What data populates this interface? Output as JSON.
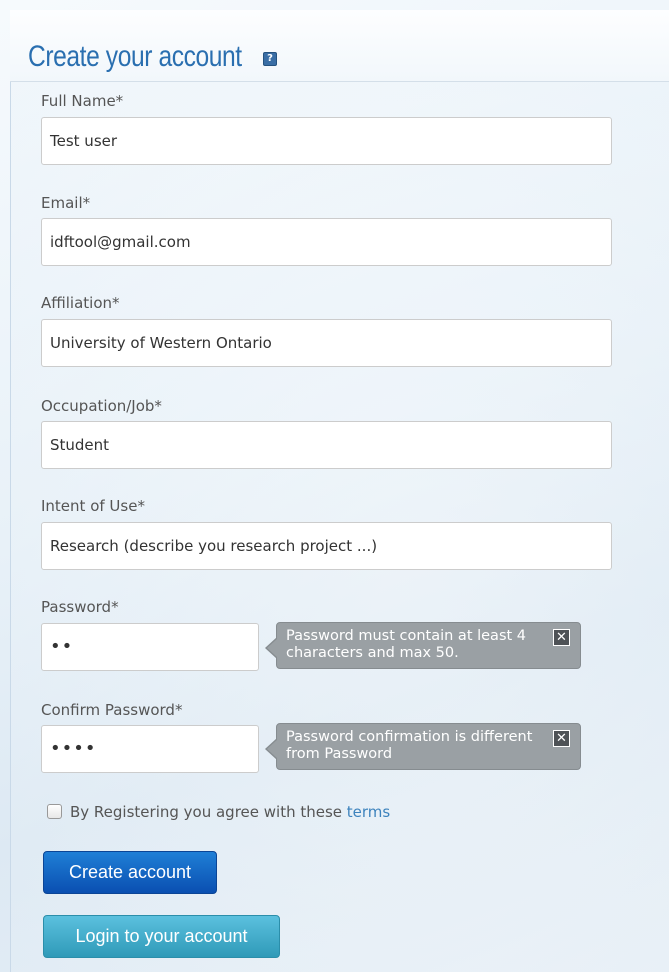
{
  "header": {
    "title": "Create your account",
    "help_icon": "help-icon"
  },
  "form": {
    "fields": [
      {
        "label": "Full Name*",
        "value": "Test user"
      },
      {
        "label": "Email*",
        "value": "idftool@gmail.com"
      },
      {
        "label": "Affiliation*",
        "value": "University of Western Ontario"
      },
      {
        "label": "Occupation/Job*",
        "value": "Student"
      },
      {
        "label": "Intent of Use*",
        "value": "Research (describe you research project ...)"
      }
    ],
    "password": {
      "label": "Password*",
      "value": "••",
      "error": "Password must contain at least 4 characters and max 50."
    },
    "confirm_password": {
      "label": "Confirm Password*",
      "value": "••••",
      "error": "Password confirmation is different from Password"
    },
    "terms": {
      "checked": false,
      "text": "By Registering you agree with these",
      "link": "terms"
    },
    "create_button": "Create account",
    "login_button": "Login to your account"
  },
  "colors": {
    "title": "#2a6fb0",
    "primary_button": "#0a4fb1",
    "secondary_button": "#2f9ab8",
    "tooltip": "#9aa0a4",
    "link": "#3d83bd"
  }
}
